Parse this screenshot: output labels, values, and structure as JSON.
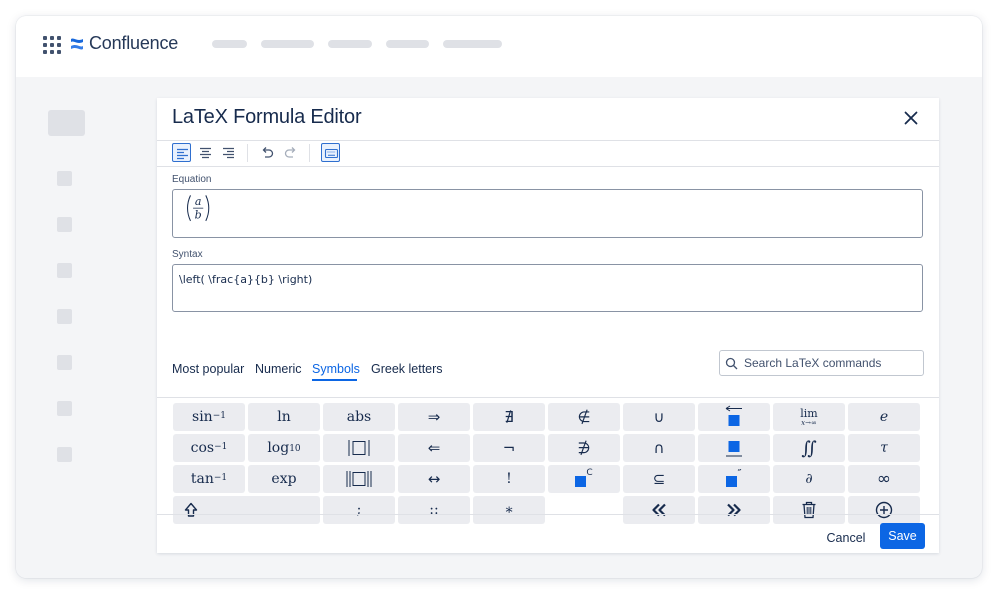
{
  "app": {
    "brand": "Confluence"
  },
  "dialog": {
    "title": "LaTeX Formula Editor",
    "equation_label": "Equation",
    "syntax_label": "Syntax",
    "syntax_value": "\\left( \\frac{a}{b} \\right)",
    "rendered": {
      "numerator": "a",
      "denominator": "b"
    }
  },
  "tabs": [
    {
      "label": "Most popular",
      "active": false
    },
    {
      "label": "Numeric",
      "active": false
    },
    {
      "label": "Symbols",
      "active": true
    },
    {
      "label": "Greek letters",
      "active": false
    }
  ],
  "search": {
    "placeholder": "Search LaTeX commands",
    "value": ""
  },
  "keys": {
    "sin_inv": {
      "base": "sin",
      "sup": "−1"
    },
    "cos_inv": {
      "base": "cos",
      "sup": "−1"
    },
    "tan_inv": {
      "base": "tan",
      "sup": "−1"
    },
    "ln": "ln",
    "log10": {
      "base": "log",
      "sub": "10"
    },
    "exp": "exp",
    "abs": "abs",
    "implies": "⇒",
    "impliedby": "⇐",
    "iff": "↔",
    "nexists": "∄",
    "neg": "¬",
    "factorial": "!",
    "notin": "∉",
    "nni": "∌",
    "complement_sup": "C",
    "cup": "∪",
    "cap": "∩",
    "subseteq": "⊆",
    "lim": "lim",
    "lim_sub": "x→∞",
    "iint": "∬",
    "partial": "∂",
    "e": "e",
    "tau": "τ",
    "infty": "∞",
    "semicolon": ";",
    "coloncolon": "::",
    "ast": "∗",
    "double_prime": "″"
  },
  "footer": {
    "cancel": "Cancel",
    "save": "Save"
  },
  "colors": {
    "accent": "#0c66e4",
    "text": "#172b4d",
    "key_bg": "#ebecf0",
    "placeholder": "#dfe1e6"
  }
}
